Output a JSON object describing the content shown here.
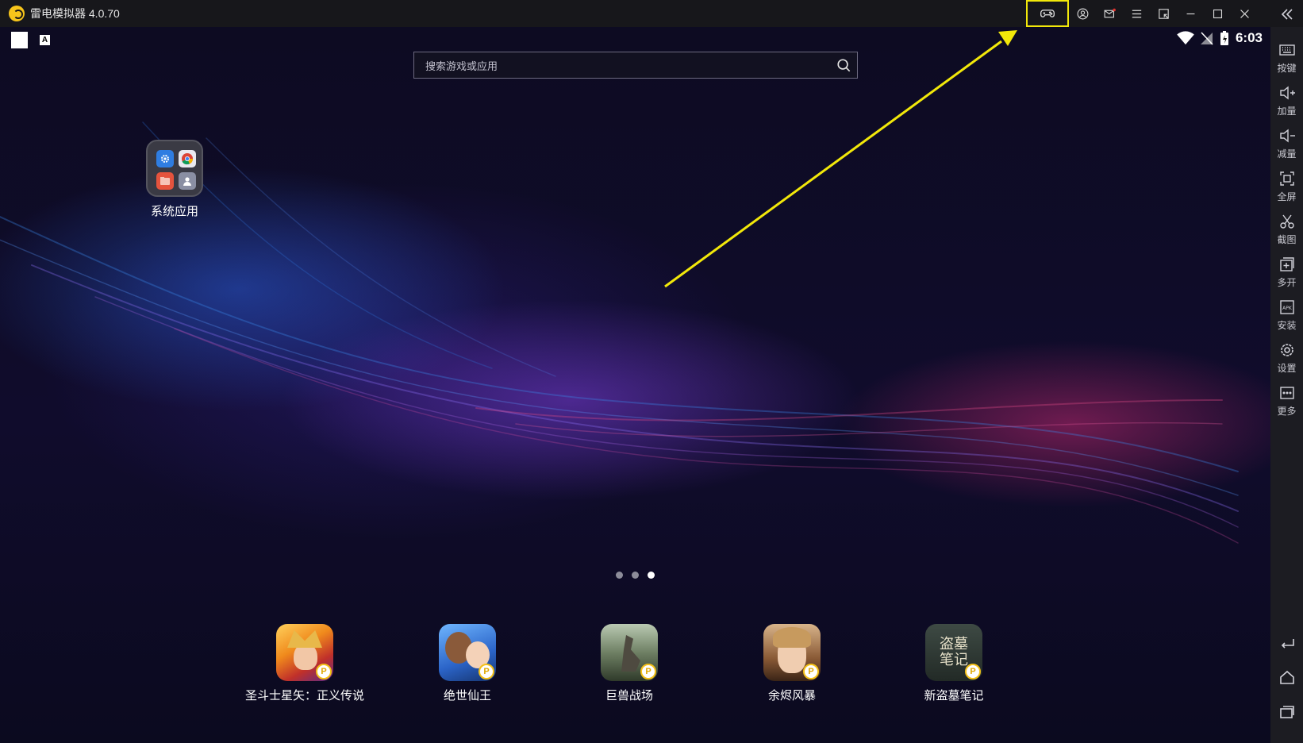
{
  "window": {
    "title": "雷电模拟器 4.0.70"
  },
  "titlebar_buttons": [
    "gamepad-icon",
    "account-icon",
    "mail-icon",
    "menu-icon",
    "shrink-icon",
    "minimize-icon",
    "maximize-icon",
    "close-icon"
  ],
  "status_bar": {
    "time": "6:03",
    "badge_letter": "A"
  },
  "search": {
    "placeholder": "搜索游戏或应用"
  },
  "folder": {
    "label": "系统应用"
  },
  "page_indicator": {
    "pages": 3,
    "current": 3
  },
  "dock": [
    {
      "label": "圣斗士星矢：正义传说",
      "badge": "P"
    },
    {
      "label": "绝世仙王",
      "badge": "P"
    },
    {
      "label": "巨兽战场",
      "badge": "P"
    },
    {
      "label": "余烬风暴",
      "badge": "P"
    },
    {
      "label": "新盗墓笔记",
      "badge": "P",
      "icon_text": "盗墓笔记"
    }
  ],
  "sidebar": {
    "items": [
      {
        "label": "按键",
        "icon": "keyboard-icon"
      },
      {
        "label": "加量",
        "icon": "volume-up-icon"
      },
      {
        "label": "减量",
        "icon": "volume-down-icon"
      },
      {
        "label": "全屏",
        "icon": "fullscreen-icon"
      },
      {
        "label": "截图",
        "icon": "scissors-icon"
      },
      {
        "label": "多开",
        "icon": "multi-instance-icon"
      },
      {
        "label": "安装",
        "icon": "apk-icon"
      },
      {
        "label": "设置",
        "icon": "settings-icon"
      },
      {
        "label": "更多",
        "icon": "more-icon"
      }
    ],
    "apk_text": "APK",
    "nav": [
      "back-icon",
      "home-icon",
      "recents-icon"
    ]
  },
  "annotation": {
    "highlight_color": "#f2e80a",
    "arrow_color": "#f2e80a"
  }
}
